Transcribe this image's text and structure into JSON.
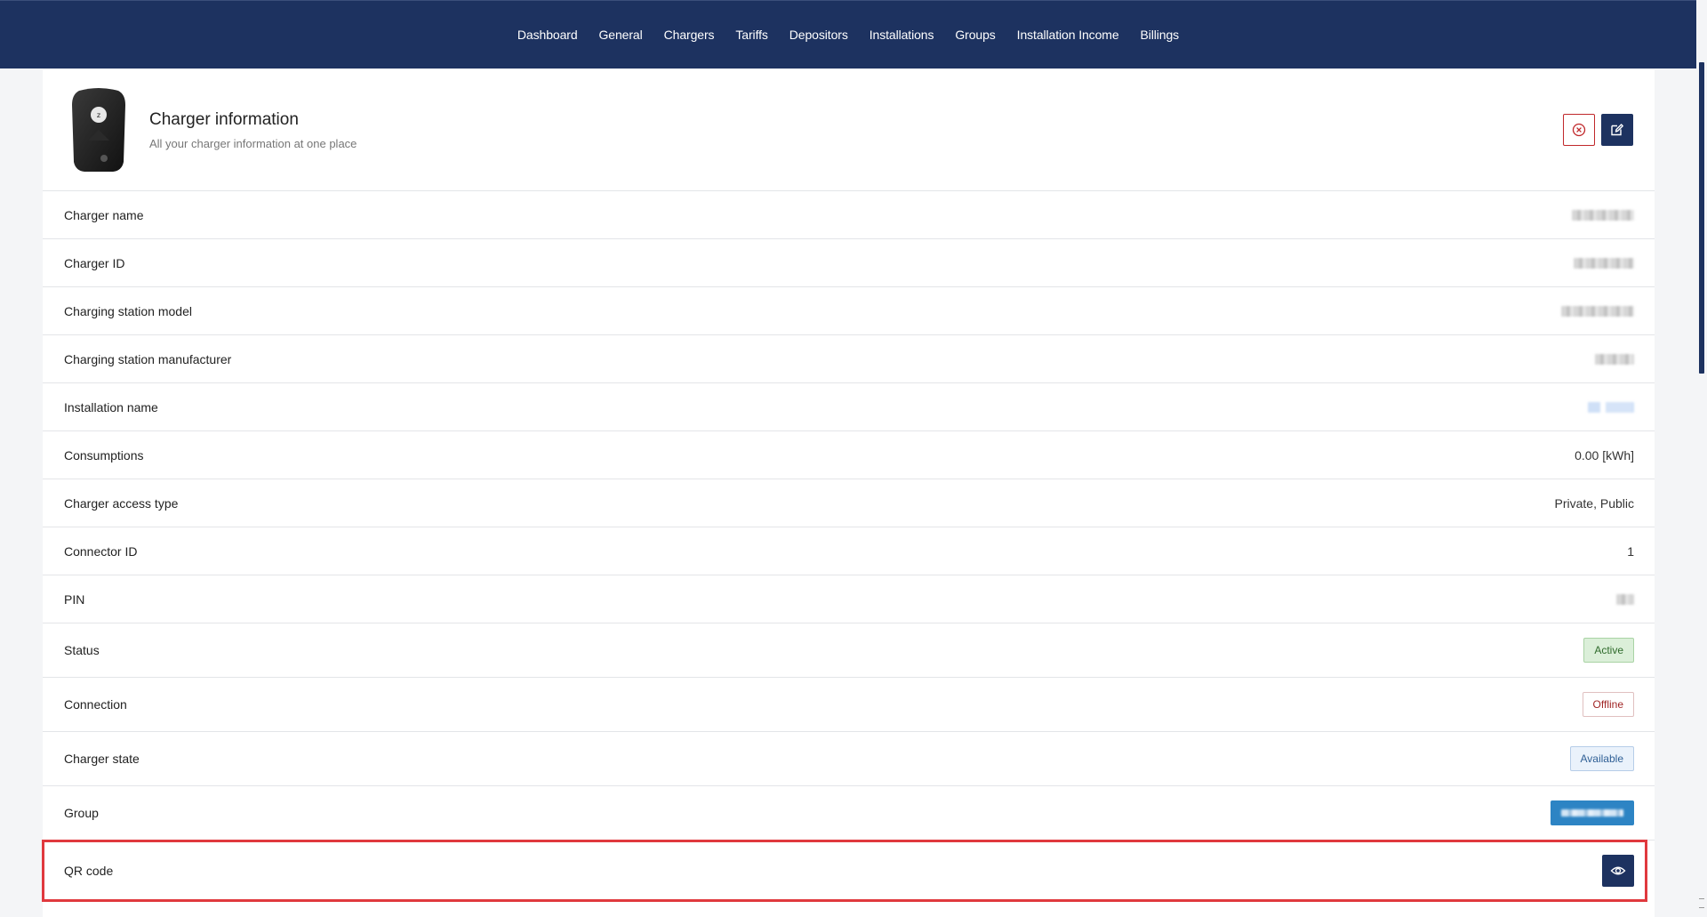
{
  "nav": {
    "items": [
      {
        "label": "Dashboard"
      },
      {
        "label": "General"
      },
      {
        "label": "Chargers"
      },
      {
        "label": "Tariffs"
      },
      {
        "label": "Depositors"
      },
      {
        "label": "Installations"
      },
      {
        "label": "Groups"
      },
      {
        "label": "Installation Income"
      },
      {
        "label": "Billings"
      }
    ]
  },
  "header": {
    "title": "Charger information",
    "subtitle": "All your charger information at one place"
  },
  "rows": {
    "charger_name": {
      "label": "Charger name"
    },
    "charger_id": {
      "label": "Charger ID"
    },
    "model": {
      "label": "Charging station model"
    },
    "manufacturer": {
      "label": "Charging station manufacturer"
    },
    "installation": {
      "label": "Installation name"
    },
    "consumptions": {
      "label": "Consumptions",
      "value": "0.00 [kWh]"
    },
    "access_type": {
      "label": "Charger access type",
      "value": "Private, Public"
    },
    "connector_id": {
      "label": "Connector ID",
      "value": "1"
    },
    "pin": {
      "label": "PIN"
    },
    "status": {
      "label": "Status",
      "value": "Active"
    },
    "connection": {
      "label": "Connection",
      "value": "Offline"
    },
    "charger_state": {
      "label": "Charger state",
      "value": "Available"
    },
    "group": {
      "label": "Group"
    },
    "qr_code": {
      "label": "QR code"
    }
  },
  "colors": {
    "nav_bg": "#1d3260",
    "highlight": "#e0393e",
    "status_active": "#2f6b2c",
    "status_offline": "#a12626",
    "status_available": "#2f5f95"
  },
  "icons": {
    "cancel": "close-circle-icon",
    "edit": "edit-icon",
    "qr_view": "eye-icon"
  }
}
